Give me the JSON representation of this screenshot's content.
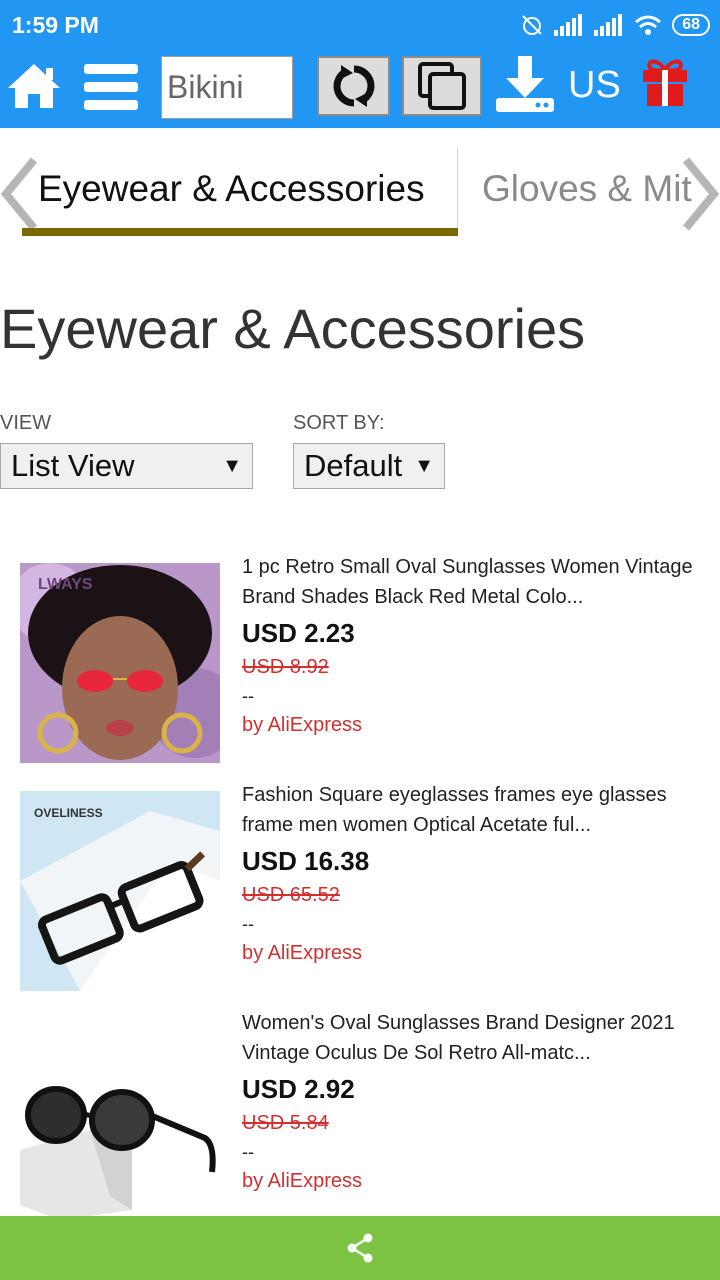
{
  "status_bar": {
    "time": "1:59 PM",
    "battery": "68"
  },
  "toolbar": {
    "search_value": "Bikini",
    "locale": "US"
  },
  "tabs": {
    "active": "Eyewear & Accessories",
    "next": "Gloves & Mittens"
  },
  "page": {
    "title": "Eyewear & Accessories"
  },
  "controls": {
    "view_label": "VIEW",
    "view_value": "List View",
    "sort_label": "SORT BY:",
    "sort_value": "Default"
  },
  "products": [
    {
      "title": "1 pc Retro Small Oval Sunglasses Women Vintage Brand Shades Black Red Metal Colo...",
      "price": "USD 2.23",
      "old_price": "USD 8.92",
      "extra": "--",
      "seller": "by AliExpress",
      "thumb_text": "LWAYS"
    },
    {
      "title": "Fashion Square eyeglasses frames eye glasses frame men women Optical Acetate ful...",
      "price": "USD 16.38",
      "old_price": "USD 65.52",
      "extra": "--",
      "seller": "by AliExpress",
      "thumb_text": "OVELINESS"
    },
    {
      "title": "Women's Oval Sunglasses Brand Designer 2021 Vintage Oculus De Sol Retro All-matc...",
      "price": "USD 2.92",
      "old_price": "USD 5.84",
      "extra": "--",
      "seller": "by AliExpress"
    }
  ],
  "colors": {
    "header": "#2196f3",
    "accent_underline": "#7a6a00",
    "old_price": "#d32f2f",
    "share_bar": "#7cc243",
    "gift": "#e01b1b"
  },
  "icons": [
    "home-icon",
    "menu-icon",
    "refresh-icon",
    "copy-icon",
    "download-icon",
    "gift-icon",
    "chevron-left-icon",
    "chevron-right-icon",
    "share-icon"
  ]
}
